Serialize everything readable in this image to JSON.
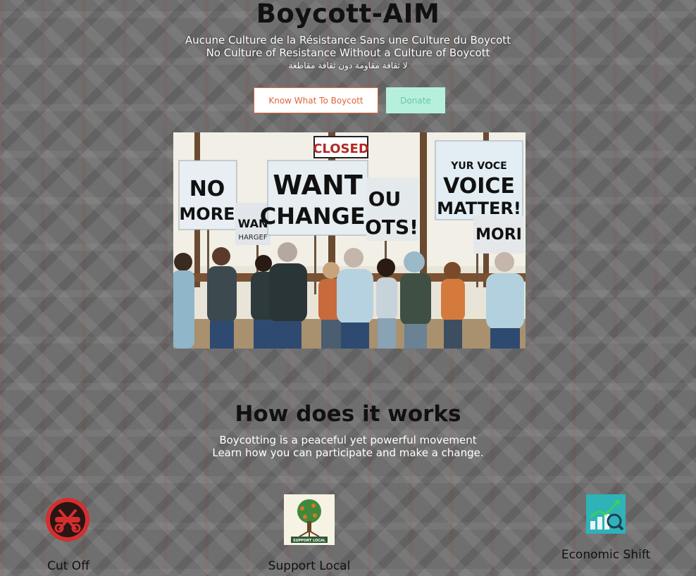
{
  "site": {
    "title": "Boycott-AIM",
    "tagline_fr": "Aucune Culture de la Résistance Sans une Culture du Boycott",
    "tagline_en": "No Culture of Resistance Without a Culture of Boycott",
    "tagline_ar": "لا ثقافة مقاومة دون ثقافة مقاطعة"
  },
  "buttons": {
    "boycott_label": "Know What To Boycott",
    "donate_label": "Donate"
  },
  "hero_image": {
    "signs": {
      "closed": "CLOSED",
      "no_more_1": "NO",
      "no_more_2": "MORE",
      "want_small": "WAN",
      "hargef": "HARGEF",
      "want_change_1": "WANT",
      "want_change_2": "CHANGE!",
      "out_1": "OU",
      "out_2": "OTS!",
      "voice_1": "YUR VOCE",
      "voice_2": "VOICE",
      "voice_3": "MATTER!",
      "mor": "MORI"
    }
  },
  "how": {
    "title": "How does it works",
    "line1": "Boycotting is a peaceful yet powerful movement",
    "line2": "Learn how you can participate and make a change."
  },
  "features": [
    {
      "label": "Cut Off",
      "icon": "cut-off-icon"
    },
    {
      "label": "Support Local",
      "icon": "support-local-icon",
      "icon_text": "SUPPORT LOCAL"
    },
    {
      "label": "Economic Shift",
      "icon": "economic-shift-icon"
    }
  ],
  "colors": {
    "boycott_button": "#e0633a",
    "donate_button_bg": "#b6f0dc",
    "donate_button_text": "#6cc6a8"
  }
}
